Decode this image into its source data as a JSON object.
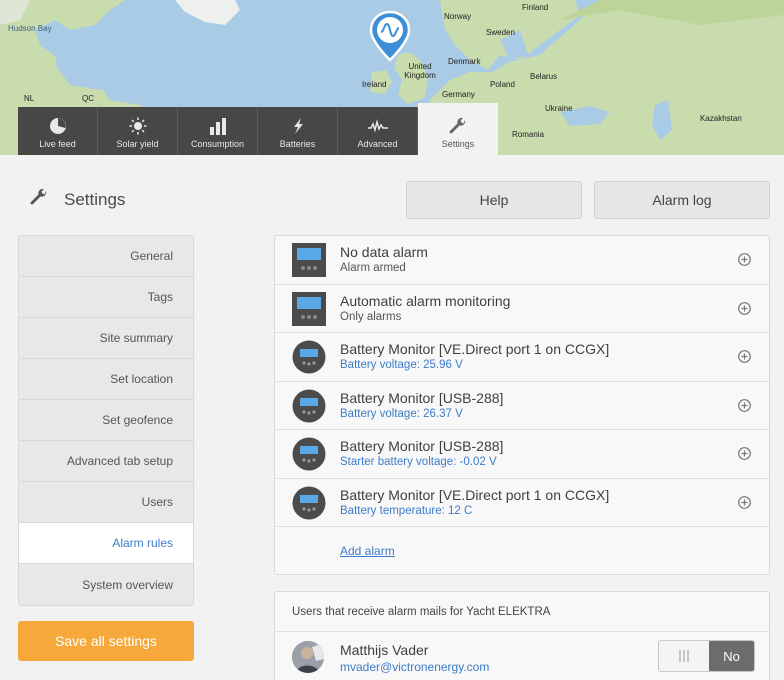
{
  "map": {
    "labels": {
      "hudson_bay": "Hudson Bay",
      "finland": "Finland",
      "norway": "Norway",
      "sweden": "Sweden",
      "denmark": "Denmark",
      "uk": "United Kingdom",
      "ireland": "Ireland",
      "poland": "Poland",
      "belarus": "Belarus",
      "germany": "Germany",
      "ukraine": "Ukraine",
      "kazakhstan": "Kazakhstan",
      "romania": "Romania",
      "nl": "NL",
      "qc": "QC"
    }
  },
  "tabs": [
    {
      "label": "Live feed",
      "icon": "pie-chart-icon"
    },
    {
      "label": "Solar yield",
      "icon": "sun-icon"
    },
    {
      "label": "Consumption",
      "icon": "bar-chart-icon"
    },
    {
      "label": "Batteries",
      "icon": "lightning-icon"
    },
    {
      "label": "Advanced",
      "icon": "waveform-icon"
    },
    {
      "label": "Settings",
      "icon": "wrench-icon"
    }
  ],
  "header": {
    "title": "Settings",
    "help_label": "Help",
    "alarm_log_label": "Alarm log"
  },
  "sidebar": {
    "items": [
      {
        "label": "General"
      },
      {
        "label": "Tags"
      },
      {
        "label": "Site summary"
      },
      {
        "label": "Set location"
      },
      {
        "label": "Set geofence"
      },
      {
        "label": "Advanced tab setup"
      },
      {
        "label": "Users"
      },
      {
        "label": "Alarm rules"
      },
      {
        "label": "System overview"
      }
    ],
    "save_label": "Save all settings"
  },
  "alarms": {
    "rows": [
      {
        "title": "No data alarm",
        "subtitle": "Alarm armed",
        "device": "ccgx"
      },
      {
        "title": "Automatic alarm monitoring",
        "subtitle": "Only alarms",
        "device": "ccgx"
      },
      {
        "title": "Battery Monitor [VE.Direct port 1 on CCGX]",
        "subtitle": "Battery voltage: 25.96 V",
        "device": "bmv"
      },
      {
        "title": "Battery Monitor [USB-288]",
        "subtitle": "Battery voltage: 26.37 V",
        "device": "bmv"
      },
      {
        "title": "Battery Monitor [USB-288]",
        "subtitle": "Starter battery voltage: -0.02 V",
        "device": "bmv"
      },
      {
        "title": "Battery Monitor [VE.Direct port 1 on CCGX]",
        "subtitle": "Battery temperature: 12 C",
        "device": "bmv"
      }
    ],
    "add_label": "Add alarm"
  },
  "users_panel": {
    "heading": "Users that receive alarm mails for Yacht ELEKTRA",
    "users": [
      {
        "name": "Matthijs Vader",
        "email": "mvader@victronenergy.com",
        "toggle_state": "No"
      }
    ]
  },
  "colors": {
    "accent_blue": "#3d7cc9",
    "save_orange": "#f6a83a",
    "tab_dark": "#474746"
  }
}
